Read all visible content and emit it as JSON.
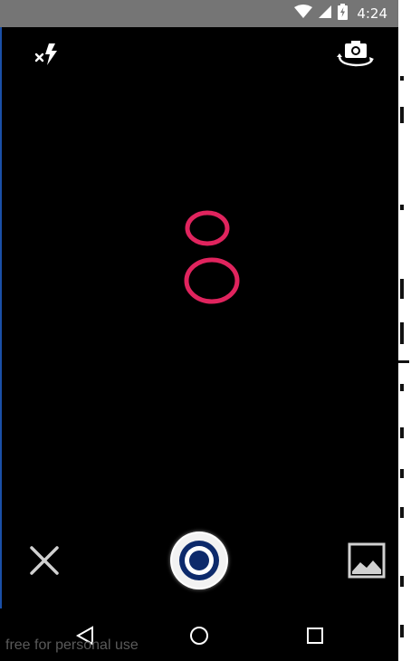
{
  "status_bar": {
    "time": "4:24",
    "icons": [
      "wifi-icon",
      "cell-signal-icon",
      "battery-charging-icon"
    ],
    "background": "#757575"
  },
  "camera": {
    "top_controls": [
      "flash-off-icon",
      "switch-camera-icon"
    ],
    "focus_color": "#e0245e",
    "bottom_controls": [
      "close-icon",
      "shutter-button",
      "gallery-icon"
    ],
    "shutter_inner_color": "#0d2a6b"
  },
  "nav_bar": {
    "buttons": [
      "back-icon",
      "home-icon",
      "recent-apps-icon"
    ]
  },
  "watermark": {
    "text": "free for personal use"
  }
}
